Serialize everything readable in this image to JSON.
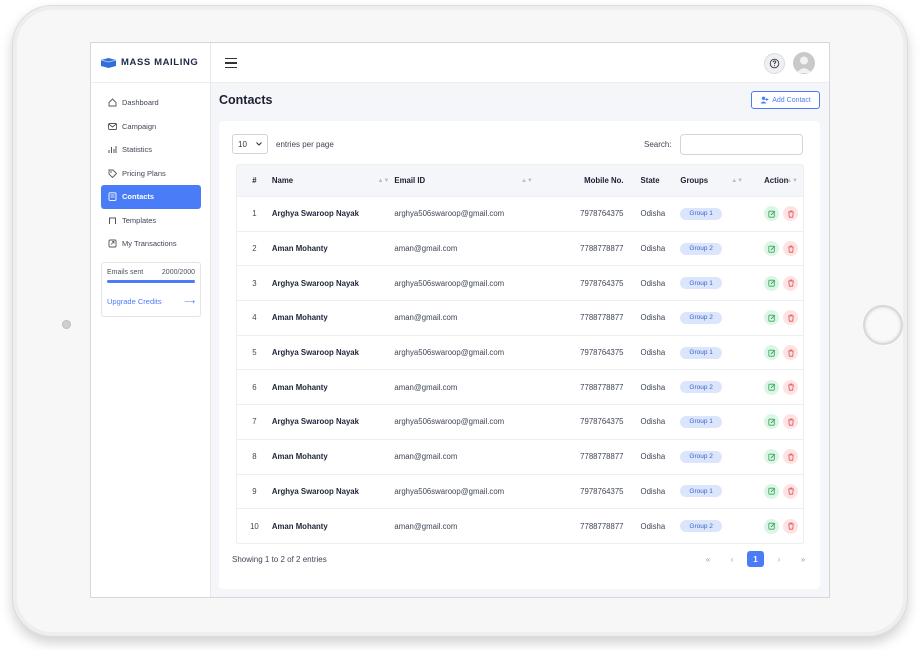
{
  "brand": {
    "name": "MASS MAILING"
  },
  "sidebar": {
    "items": [
      {
        "label": "Dashboard",
        "icon": "home-icon",
        "active": false
      },
      {
        "label": "Campaign",
        "icon": "mail-icon",
        "active": false
      },
      {
        "label": "Statistics",
        "icon": "chart-icon",
        "active": false
      },
      {
        "label": "Pricing Plans",
        "icon": "tag-icon",
        "active": false
      },
      {
        "label": "Contacts",
        "icon": "contacts-icon",
        "active": true
      },
      {
        "label": "Templates",
        "icon": "template-icon",
        "active": false
      },
      {
        "label": "My Transactions",
        "icon": "transactions-icon",
        "active": false
      }
    ],
    "credits": {
      "label": "Emails sent",
      "value": "2000/2000",
      "progress": 1.0,
      "upgrade_label": "Upgrade Credits",
      "upgrade_arrow": "⟶"
    }
  },
  "page": {
    "title": "Contacts",
    "add_button": "Add Contact"
  },
  "table_controls": {
    "page_size": "10",
    "entries_label": "entries per page",
    "search_label": "Search:"
  },
  "table": {
    "headers": {
      "num": "#",
      "name": "Name",
      "email": "Email ID",
      "mobile": "Mobile No.",
      "state": "State",
      "groups": "Groups",
      "action": "Action"
    },
    "rows": [
      {
        "num": "1",
        "name": "Arghya Swaroop Nayak",
        "email": "arghya506swaroop@gmail.com",
        "mobile": "7978764375",
        "state": "Odisha",
        "group": "Group 1"
      },
      {
        "num": "2",
        "name": "Aman Mohanty",
        "email": "aman@gmail.com",
        "mobile": "7788778877",
        "state": "Odisha",
        "group": "Group 2"
      },
      {
        "num": "3",
        "name": "Arghya Swaroop Nayak",
        "email": "arghya506swaroop@gmail.com",
        "mobile": "7978764375",
        "state": "Odisha",
        "group": "Group 1"
      },
      {
        "num": "4",
        "name": "Aman Mohanty",
        "email": "aman@gmail.com",
        "mobile": "7788778877",
        "state": "Odisha",
        "group": "Group 2"
      },
      {
        "num": "5",
        "name": "Arghya Swaroop Nayak",
        "email": "arghya506swaroop@gmail.com",
        "mobile": "7978764375",
        "state": "Odisha",
        "group": "Group 1"
      },
      {
        "num": "6",
        "name": "Aman Mohanty",
        "email": "aman@gmail.com",
        "mobile": "7788778877",
        "state": "Odisha",
        "group": "Group 2"
      },
      {
        "num": "7",
        "name": "Arghya Swaroop Nayak",
        "email": "arghya506swaroop@gmail.com",
        "mobile": "7978764375",
        "state": "Odisha",
        "group": "Group 1"
      },
      {
        "num": "8",
        "name": "Aman Mohanty",
        "email": "aman@gmail.com",
        "mobile": "7788778877",
        "state": "Odisha",
        "group": "Group 2"
      },
      {
        "num": "9",
        "name": "Arghya Swaroop Nayak",
        "email": "arghya506swaroop@gmail.com",
        "mobile": "7978764375",
        "state": "Odisha",
        "group": "Group 1"
      },
      {
        "num": "10",
        "name": "Aman Mohanty",
        "email": "aman@gmail.com",
        "mobile": "7788778877",
        "state": "Odisha",
        "group": "Group 2"
      }
    ]
  },
  "footer": {
    "info": "Showing 1 to 2 of 2 entries",
    "pager": {
      "first": "«",
      "prev": "‹",
      "current": "1",
      "next": "›",
      "last": "»"
    }
  },
  "colors": {
    "accent": "#4a7cf7",
    "edit": "#dcf5e4",
    "delete": "#fde3e3",
    "badge": "#dbe6fd"
  }
}
